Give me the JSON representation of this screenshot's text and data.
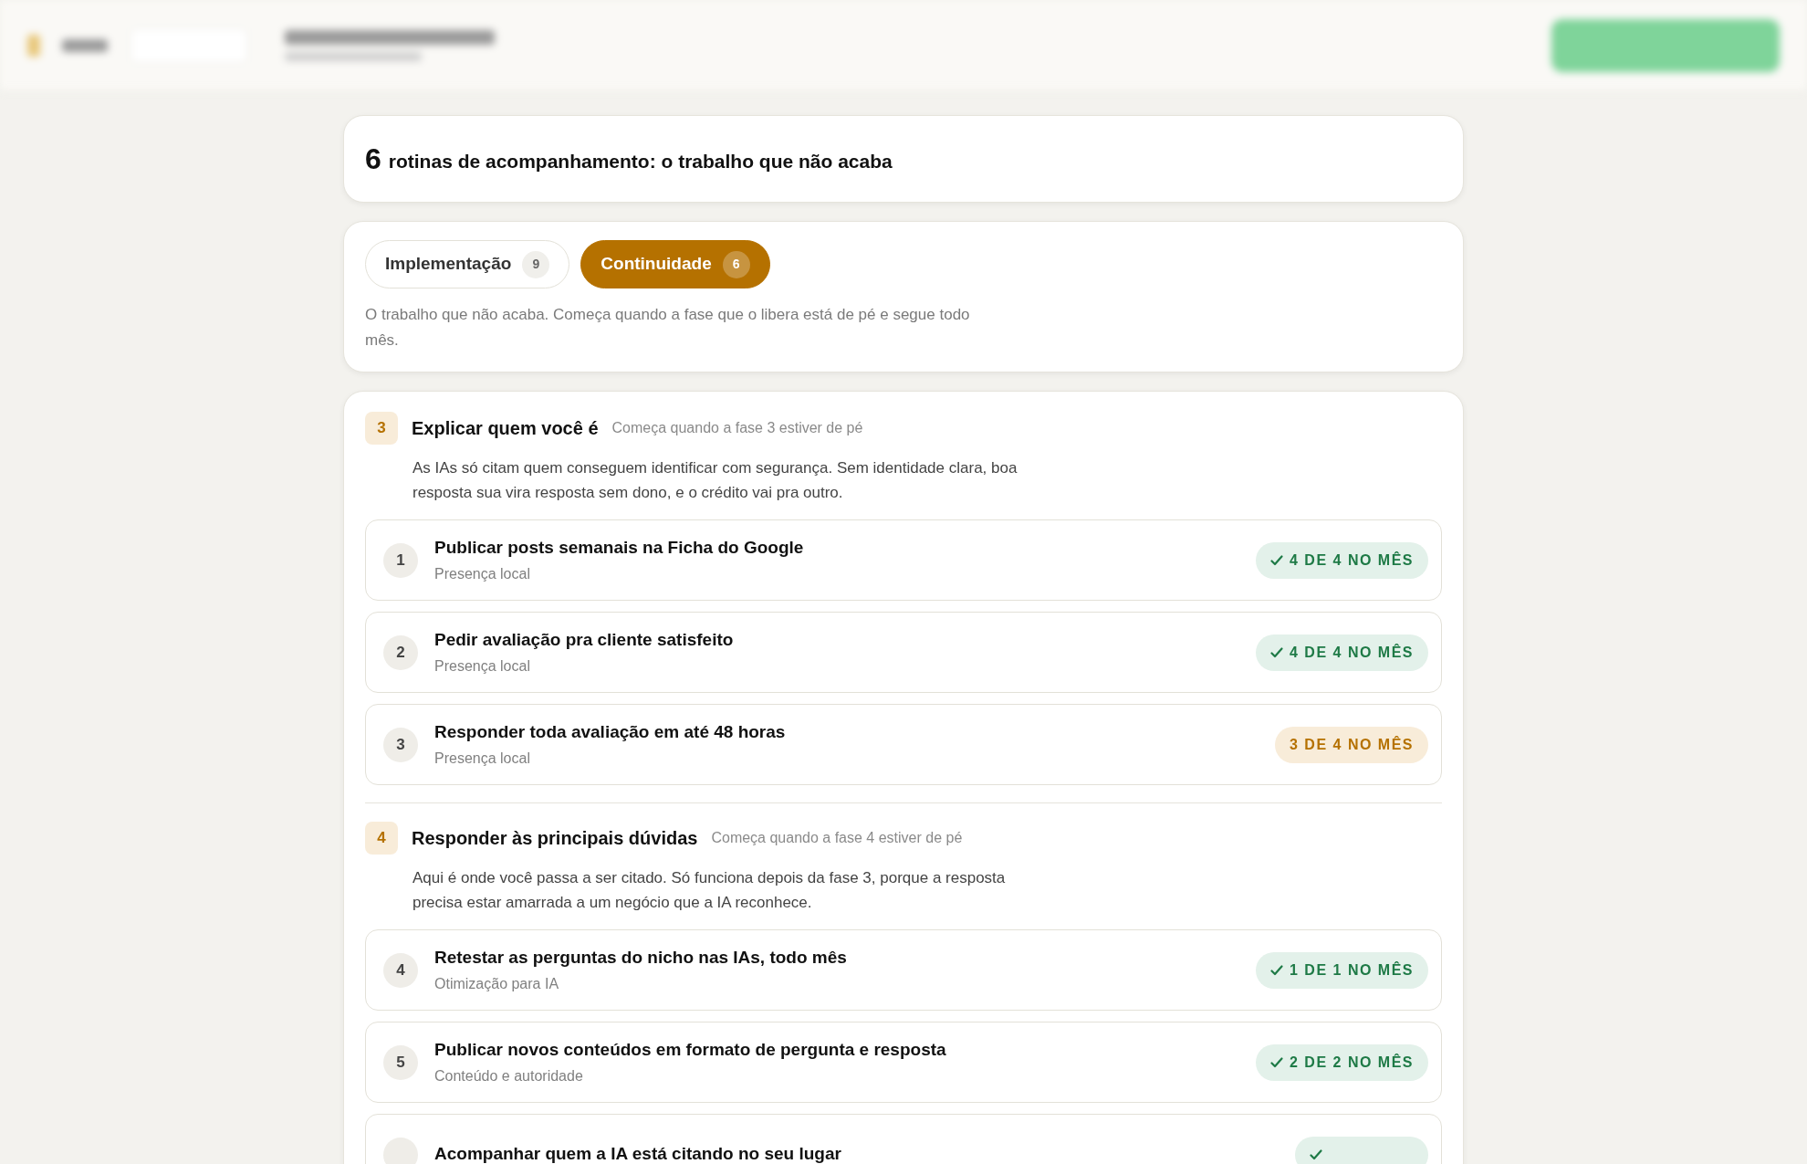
{
  "summary": {
    "count": "6",
    "text": "rotinas de acompanhamento: o trabalho que não acaba"
  },
  "tabs": [
    {
      "label": "Implementação",
      "count": "9",
      "selected": false
    },
    {
      "label": "Continuidade",
      "count": "6",
      "selected": true
    }
  ],
  "tab_description": "O trabalho que não acaba. Começa quando a fase que o libera está de pé e segue todo mês.",
  "phases": [
    {
      "number": "3",
      "title": "Explicar quem você é",
      "condition": "Começa quando a fase 3 estiver de pé",
      "description": "As IAs só citam quem conseguem identificar com segurança. Sem identidade clara, boa resposta sua vira resposta sem dono, e o crédito vai pra outro.",
      "routines": [
        {
          "number": "1",
          "title": "Publicar posts semanais na Ficha do Google",
          "category": "Presença local",
          "badge": "4 DE 4 NO MÊS",
          "complete": true
        },
        {
          "number": "2",
          "title": "Pedir avaliação pra cliente satisfeito",
          "category": "Presença local",
          "badge": "4 DE 4 NO MÊS",
          "complete": true
        },
        {
          "number": "3",
          "title": "Responder toda avaliação em até 48 horas",
          "category": "Presença local",
          "badge": "3 DE 4 NO MÊS",
          "complete": false
        }
      ]
    },
    {
      "number": "4",
      "title": "Responder às principais dúvidas",
      "condition": "Começa quando a fase 4 estiver de pé",
      "description": "Aqui é onde você passa a ser citado. Só funciona depois da fase 3, porque a resposta precisa estar amarrada a um negócio que a IA reconhece.",
      "routines": [
        {
          "number": "4",
          "title": "Retestar as perguntas do nicho nas IAs, todo mês",
          "category": "Otimização para IA",
          "badge": "1 DE 1 NO MÊS",
          "complete": true
        },
        {
          "number": "5",
          "title": "Publicar novos conteúdos em formato de pergunta e resposta",
          "category": "Conteúdo e autoridade",
          "badge": "2 DE 2 NO MÊS",
          "complete": true
        },
        {
          "title": "Acompanhar quem a IA está citando no seu lugar",
          "complete": true
        }
      ]
    }
  ]
}
